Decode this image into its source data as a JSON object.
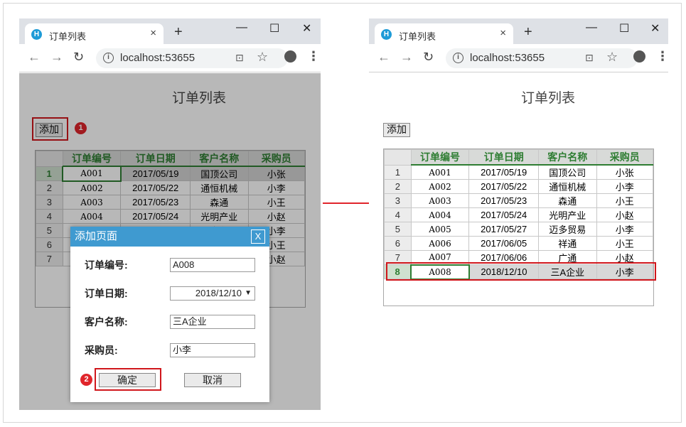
{
  "browser": {
    "tab_title": "订单列表",
    "tab_close": "×",
    "new_tab": "+",
    "minimize": "—",
    "maximize": "☐",
    "close": "✕",
    "url": "localhost:53655"
  },
  "page": {
    "title": "订单列表",
    "add_label": "添加"
  },
  "table": {
    "headers": [
      "订单编号",
      "订单日期",
      "客户名称",
      "采购员"
    ],
    "rows_before": [
      {
        "n": "1",
        "id": "A001",
        "date": "2017/05/19",
        "customer": "国顶公司",
        "buyer": "小张"
      },
      {
        "n": "2",
        "id": "A002",
        "date": "2017/05/22",
        "customer": "通恒机械",
        "buyer": "小李"
      },
      {
        "n": "3",
        "id": "A003",
        "date": "2017/05/23",
        "customer": "森通",
        "buyer": "小王"
      },
      {
        "n": "4",
        "id": "A004",
        "date": "2017/05/24",
        "customer": "光明产业",
        "buyer": "小赵"
      },
      {
        "n": "5",
        "id": "A005",
        "date": "2017/05/27",
        "customer": "迈多贸易",
        "buyer": "小李"
      },
      {
        "n": "6",
        "id": "A006",
        "date": "2017/06/05",
        "customer": "祥通",
        "buyer": "小王"
      },
      {
        "n": "7",
        "id": "A007",
        "date": "2017/06/06",
        "customer": "广通",
        "buyer": "小赵"
      }
    ],
    "new_row": {
      "n": "8",
      "id": "A008",
      "date": "2018/12/10",
      "customer": "三A企业",
      "buyer": "小李"
    }
  },
  "dialog": {
    "title": "添加页面",
    "close": "X",
    "fields": {
      "id_label": "订单编号:",
      "id_value": "A008",
      "date_label": "订单日期:",
      "date_value": "2018/12/10",
      "customer_label": "客户名称:",
      "customer_value": "三A企业",
      "buyer_label": "采购员:",
      "buyer_value": "小李"
    },
    "ok": "确定",
    "cancel": "取消"
  },
  "annotations": {
    "step1": "1",
    "step2": "2"
  },
  "colors": {
    "header_text": "#2e7d32",
    "callout": "#d0171c",
    "dialog_header": "#3f9ad0",
    "arrow": "#e0252b"
  }
}
